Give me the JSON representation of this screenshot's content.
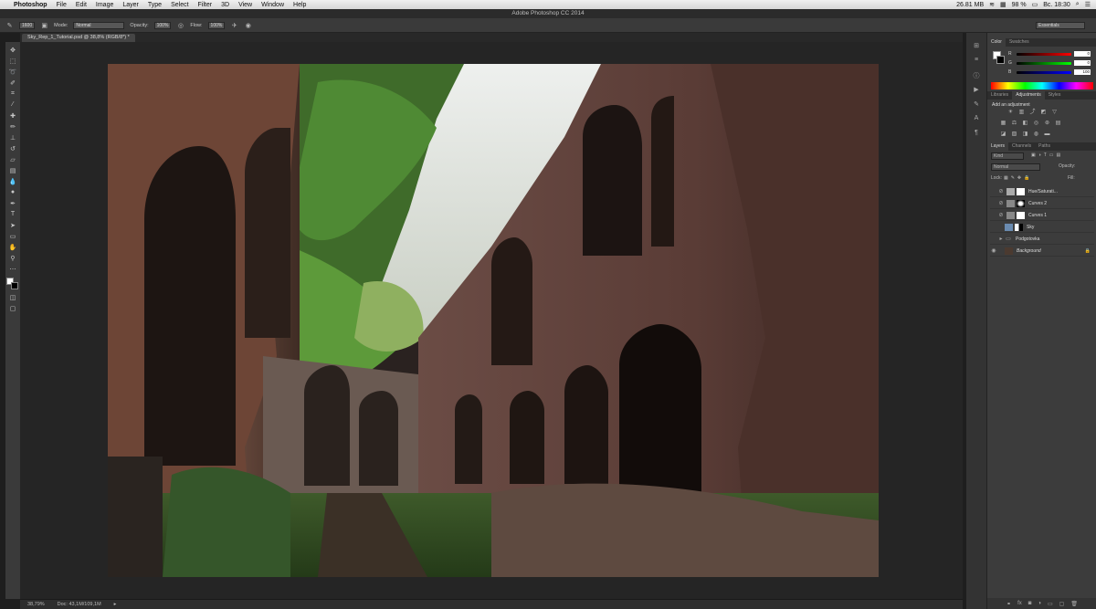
{
  "menubar": {
    "apple": "",
    "app_name": "Photoshop",
    "items": [
      "File",
      "Edit",
      "Image",
      "Layer",
      "Type",
      "Select",
      "Filter",
      "3D",
      "View",
      "Window",
      "Help"
    ],
    "status": {
      "memory": "26.81 MB",
      "battery": "98 %",
      "clock": "Вс. 18:30"
    }
  },
  "window": {
    "title": "Adobe Photoshop CC 2014"
  },
  "options_bar": {
    "brush_size": "1600",
    "mode_label": "Mode:",
    "mode_value": "Normal",
    "opacity_label": "Opacity:",
    "opacity_value": "100%",
    "flow_label": "Flow:",
    "flow_value": "100%",
    "workspace": "Essentials"
  },
  "document": {
    "tab_title": "Sky_Rep_1_Tutorial.psd @ 38,8% (RGB/8*) *"
  },
  "statusbar": {
    "zoom": "38,79%",
    "doc_size": "Doc: 43,1M/109,1M"
  },
  "panels": {
    "color": {
      "tabs": [
        "Color",
        "Swatches"
      ],
      "channels": [
        {
          "label": "R",
          "value": "0"
        },
        {
          "label": "G",
          "value": "0"
        },
        {
          "label": "B",
          "value": "100"
        }
      ]
    },
    "adjustments": {
      "tabs": [
        "Libraries",
        "Adjustments",
        "Styles"
      ],
      "heading": "Add an adjustment"
    },
    "layers": {
      "tabs": [
        "Layers",
        "Channels",
        "Paths"
      ],
      "kind": "Kind",
      "blend_mode": "Normal",
      "opacity_label": "Opacity:",
      "lock_label": "Lock:",
      "fill_label": "Fill:",
      "items": [
        {
          "name": "Hue/Saturati..."
        },
        {
          "name": "Curves 2"
        },
        {
          "name": "Curves 1"
        },
        {
          "name": "Sky"
        },
        {
          "name": "Podgotovka"
        },
        {
          "name": "Background"
        }
      ]
    }
  }
}
